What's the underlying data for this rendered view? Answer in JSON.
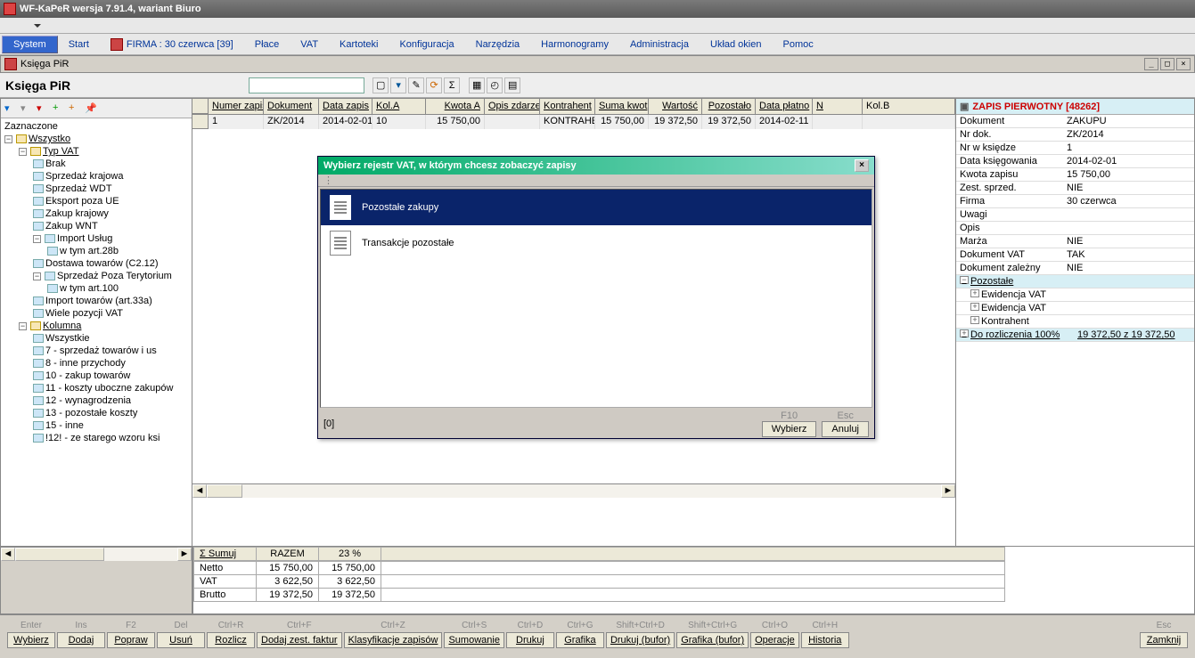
{
  "app": {
    "title": "WF-KaPeR wersja 7.91.4, wariant Biuro"
  },
  "menubar": {
    "system": "System",
    "items": [
      "Start",
      "FIRMA : 30 czerwca [39]",
      "Płace",
      "VAT",
      "Kartoteki",
      "Konfiguracja",
      "Narzędzia",
      "Harmonogramy",
      "Administracja",
      "Układ okien",
      "Pomoc"
    ]
  },
  "subwin": {
    "title": "Księga PiR"
  },
  "panel": {
    "label": "Księga PiR",
    "search": ""
  },
  "tree": {
    "root0": "Zaznaczone",
    "root1": "Wszystko",
    "typvat": "Typ VAT",
    "typvat_items": [
      "Brak",
      "Sprzedaż krajowa",
      "Sprzedaż WDT",
      "Eksport poza UE",
      "Zakup krajowy",
      "Zakup WNT"
    ],
    "import_uslug": "Import Usług",
    "import_uslug_sub": "w tym art.28b",
    "dostawa": "Dostawa towarów (C2.12)",
    "sprzedaz_poza": "Sprzedaż Poza Terytorium",
    "sprzedaz_poza_sub": "w tym art.100",
    "import_towarow": "Import towarów (art.33a)",
    "wiele_pozycji": "Wiele pozycji VAT",
    "kolumna": "Kolumna",
    "kolumna_items": [
      "Wszystkie",
      "7  - sprzedaż towarów i us",
      "8  - inne przychody",
      "10 - zakup towarów",
      "11 - koszty uboczne zakupów",
      "12 - wynagrodzenia",
      "13 - pozostałe koszty",
      "15 - inne",
      "!12! - ze starego wzoru ksi"
    ]
  },
  "grid": {
    "headers": [
      "Numer zapis",
      "Dokument",
      "Data zapis",
      "Kol.A",
      "Kwota A",
      "Opis zdarzer",
      "Kontrahent",
      "Suma kwot",
      "Wartość",
      "Pozostało",
      "Data płatno",
      "N",
      "Kol.B"
    ],
    "row": {
      "num": "1",
      "dok": "ZK/2014",
      "data": "2014-02-01",
      "kola": "10",
      "kwotaa": "15 750,00",
      "opis": "",
      "kontr": "KONTRAHEI",
      "suma": "15 750,00",
      "wartosc": "19 372,50",
      "pozost": "19 372,50",
      "dataplat": "2014-02-11",
      "n": "",
      "kolb": ""
    }
  },
  "details": {
    "title": "ZAPIS PIERWOTNY [48262]",
    "rows": [
      {
        "k": "Dokument",
        "v": "ZAKUPU"
      },
      {
        "k": "Nr dok.",
        "v": "ZK/2014"
      },
      {
        "k": "Nr w księdze",
        "v": "1"
      },
      {
        "k": "Data księgowania",
        "v": "2014-02-01"
      },
      {
        "k": "Kwota zapisu",
        "v": "15 750,00"
      },
      {
        "k": "Zest. sprzed.",
        "v": "NIE"
      },
      {
        "k": "Firma",
        "v": "30 czerwca"
      },
      {
        "k": "Uwagi",
        "v": ""
      },
      {
        "k": "Opis",
        "v": ""
      },
      {
        "k": "Marża",
        "v": "NIE"
      },
      {
        "k": "Dokument VAT",
        "v": "TAK"
      },
      {
        "k": "Dokument zależny",
        "v": "NIE"
      }
    ],
    "pozostale": "Pozostałe",
    "exp_rows": [
      {
        "k": "Ewidencja VAT",
        "v": ""
      },
      {
        "k": "Ewidencja VAT",
        "v": ""
      },
      {
        "k": "Kontrahent",
        "v": ""
      }
    ],
    "rozlicz": {
      "k": "Do rozliczenia 100%",
      "v": "19 372,50 z 19 372,50"
    }
  },
  "modal": {
    "title": "Wybierz rejestr VAT, w którym chcesz zobaczyć zapisy",
    "items": [
      "Pozostałe zakupy",
      "Transakcje pozostałe"
    ],
    "status": "[0]",
    "f10": "F10",
    "esc": "Esc",
    "btn_wybierz": "Wybierz",
    "btn_anuluj": "Anuluj"
  },
  "summary": {
    "sumuj": "Σ  Sumuj",
    "razem_h": "RAZEM",
    "pct_h": "23 %",
    "rows": [
      {
        "l": "Netto",
        "r": "15 750,00",
        "p": "15 750,00"
      },
      {
        "l": "VAT",
        "r": "3 622,50",
        "p": "3 622,50"
      },
      {
        "l": "Brutto",
        "r": "19 372,50",
        "p": "19 372,50"
      }
    ]
  },
  "shortcuts": [
    {
      "hint": "Enter",
      "label": "Wybierz"
    },
    {
      "hint": "Ins",
      "label": "Dodaj"
    },
    {
      "hint": "F2",
      "label": "Popraw"
    },
    {
      "hint": "Del",
      "label": "Usuń"
    },
    {
      "hint": "Ctrl+R",
      "label": "Rozlicz"
    },
    {
      "hint": "Ctrl+F",
      "label": "Dodaj zest. faktur"
    },
    {
      "hint": "Ctrl+Z",
      "label": "Klasyfikacje zapisów"
    },
    {
      "hint": "Ctrl+S",
      "label": "Sumowanie"
    },
    {
      "hint": "Ctrl+D",
      "label": "Drukuj"
    },
    {
      "hint": "Ctrl+G",
      "label": "Grafika"
    },
    {
      "hint": "Shift+Ctrl+D",
      "label": "Drukuj (bufor)"
    },
    {
      "hint": "Shift+Ctrl+G",
      "label": "Grafika (bufor)"
    },
    {
      "hint": "Ctrl+O",
      "label": "Operacje"
    },
    {
      "hint": "Ctrl+H",
      "label": "Historia"
    }
  ],
  "shortcut_close": {
    "hint": "Esc",
    "label": "Zamknij"
  }
}
